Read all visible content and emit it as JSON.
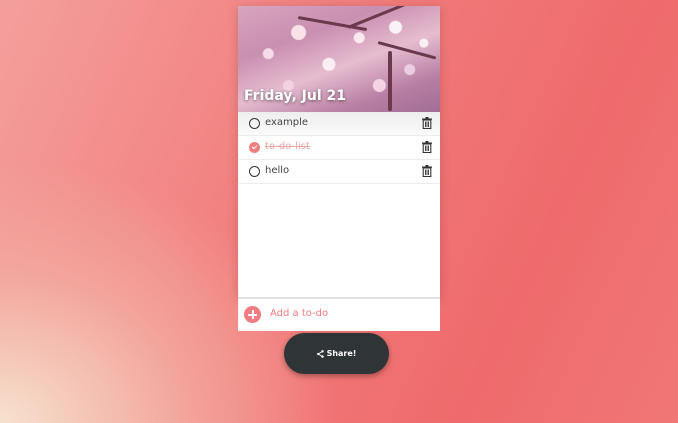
{
  "header": {
    "date": "Friday, Jul 21"
  },
  "todos": [
    {
      "label": "example",
      "done": false
    },
    {
      "label": "to-do-list",
      "done": true
    },
    {
      "label": "hello",
      "done": false
    }
  ],
  "add_bar": {
    "label": "Add a to-do"
  },
  "share": {
    "label": "Share!"
  },
  "colors": {
    "accent": "#f17b80",
    "button_dark": "#2f3437"
  }
}
